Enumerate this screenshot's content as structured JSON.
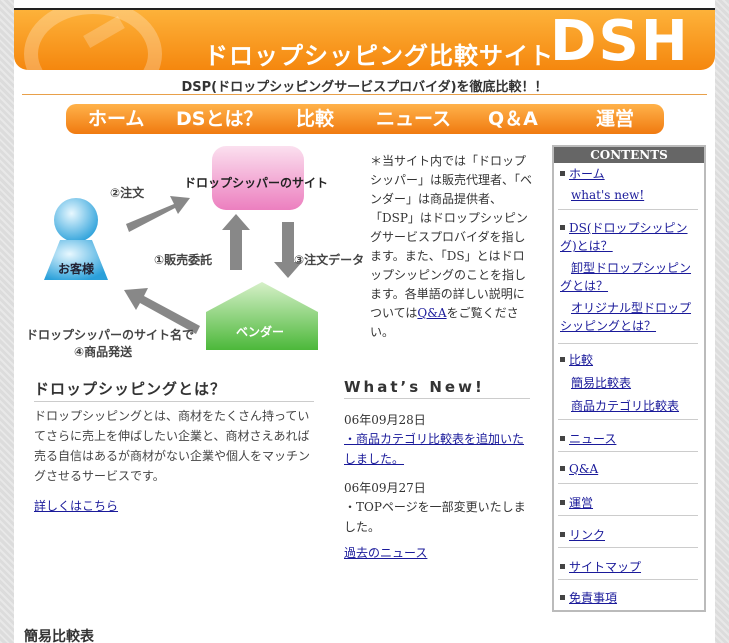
{
  "header": {
    "site_title": "ドロップシッピング比較サイト",
    "logo": "DSH"
  },
  "tagline": "DSP(ドロップシッピングサービスプロバイダ)を徹底比較！！",
  "nav": {
    "items": [
      {
        "label": "ホーム"
      },
      {
        "label": "DSとは？"
      },
      {
        "label": "比較"
      },
      {
        "label": "ニュース"
      },
      {
        "label": "Q＆A"
      },
      {
        "label": "運営"
      }
    ]
  },
  "diagram": {
    "dropshipper_site": "ドロップシッパーのサイト",
    "customer": "お客様",
    "vendor": "ベンダー",
    "step1": "①販売委託",
    "step2": "②注文",
    "step3": "③注文データ",
    "step4_line1": "ドロップシッパーのサイト名で",
    "step4_line2": "④商品発送"
  },
  "intro": {
    "text": "＊当サイト内では「ドロップシッパー」は販売代理者、「ベンダー」は商品提供者、「DSP」はドロップシッピングサービスプロバイダを指します。また、「DS」とはドロップシッピングのことを指します。各単語の詳しい説明については",
    "link": "Q&A",
    "suffix": "をご覧ください。"
  },
  "sidebar": {
    "heading": "CONTENTS",
    "items": [
      {
        "label": "ホーム"
      },
      {
        "label": "what's new!"
      },
      {
        "label": "DS(ドロップシッピング)とは？"
      },
      {
        "label": "卸型ドロップシッピングとは？"
      },
      {
        "label": "オリジナル型ドロップシッピングとは？"
      },
      {
        "label": "比較"
      },
      {
        "label": "簡易比較表"
      },
      {
        "label": "商品カテゴリ比較表"
      },
      {
        "label": "ニュース"
      },
      {
        "label": "Q&A"
      },
      {
        "label": "運営"
      },
      {
        "label": "リンク"
      },
      {
        "label": "サイトマップ"
      },
      {
        "label": "免責事項"
      }
    ]
  },
  "about": {
    "title": "ドロップシッピングとは？",
    "body": "ドロップシッピングとは、商材をたくさん持っていてさらに売上を伸ばしたい企業と、商材さえあれば売る自信はあるが商材がない企業や個人をマッチングさせるサービスです。",
    "more_link": "詳しくはこちら"
  },
  "news": {
    "title": "What’s New!",
    "entries": [
      {
        "date": "06年09月28日",
        "text": "・商品カテゴリ比較表を追加いたしました。"
      },
      {
        "date": "06年09月27日",
        "text": "・TOPページを一部変更いたしました。"
      }
    ],
    "past_link": "過去のニュース"
  },
  "bottom": {
    "title": "簡易比較表"
  },
  "colors": {
    "header_orange": "#f5870e",
    "link_blue": "#1a1a9a",
    "vendor_green": "#5cc04a",
    "site_pink": "#f08cc4",
    "customer_blue": "#3aa8e0"
  }
}
